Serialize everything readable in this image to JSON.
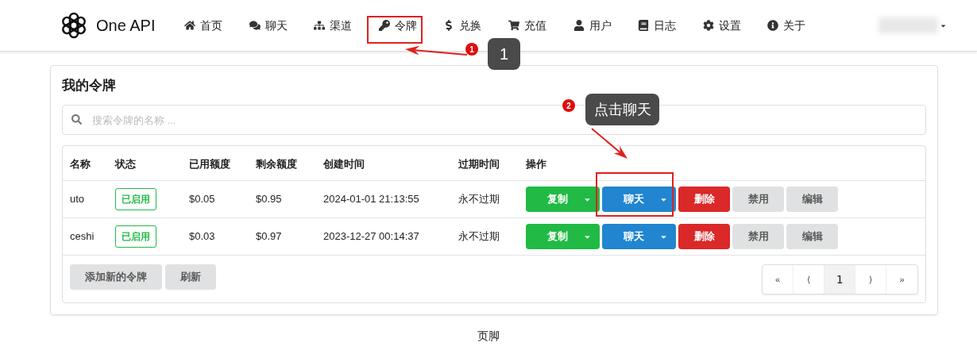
{
  "nav": {
    "brand": "One API",
    "items": [
      {
        "label": "首页"
      },
      {
        "label": "聊天"
      },
      {
        "label": "渠道"
      },
      {
        "label": "令牌"
      },
      {
        "label": "兑换"
      },
      {
        "label": "充值"
      },
      {
        "label": "用户"
      },
      {
        "label": "日志"
      },
      {
        "label": "设置"
      },
      {
        "label": "关于"
      }
    ]
  },
  "card": {
    "title": "我的令牌",
    "search": {
      "placeholder": "搜索令牌的名称 ..."
    },
    "table": {
      "columns": [
        "名称",
        "状态",
        "已用额度",
        "剩余额度",
        "创建时间",
        "过期时间",
        "操作"
      ],
      "rows": [
        {
          "name": "uto",
          "status": "已启用",
          "used": "$0.05",
          "remaining": "$0.95",
          "created": "2024-01-01 21:13:55",
          "expires": "永不过期",
          "actions": [
            {
              "label": "复制",
              "kind": "copy"
            },
            {
              "label": "聊天",
              "kind": "chat"
            },
            {
              "label": "删除",
              "kind": "delete"
            },
            {
              "label": "禁用",
              "kind": "toggle"
            },
            {
              "label": "编辑",
              "kind": "edit"
            }
          ]
        },
        {
          "name": "ceshi",
          "status": "已启用",
          "used": "$0.03",
          "remaining": "$0.97",
          "created": "2023-12-27 00:14:37",
          "expires": "永不过期",
          "actions": [
            {
              "label": "复制",
              "kind": "copy"
            },
            {
              "label": "聊天",
              "kind": "chat"
            },
            {
              "label": "删除",
              "kind": "delete"
            },
            {
              "label": "禁用",
              "kind": "toggle"
            },
            {
              "label": "编辑",
              "kind": "edit"
            }
          ]
        }
      ]
    },
    "footer_buttons": [
      "添加新的令牌",
      "刷新"
    ],
    "pagination": [
      {
        "label": "«",
        "selected": false
      },
      {
        "label": "⟨",
        "selected": false
      },
      {
        "label": "1",
        "selected": true
      },
      {
        "label": "⟩",
        "selected": false
      },
      {
        "label": "»",
        "selected": false
      }
    ]
  },
  "footer": "页脚",
  "annotations": [
    {
      "badge": "1",
      "callout": "1"
    },
    {
      "badge": "2",
      "callout": "点击聊天"
    }
  ]
}
